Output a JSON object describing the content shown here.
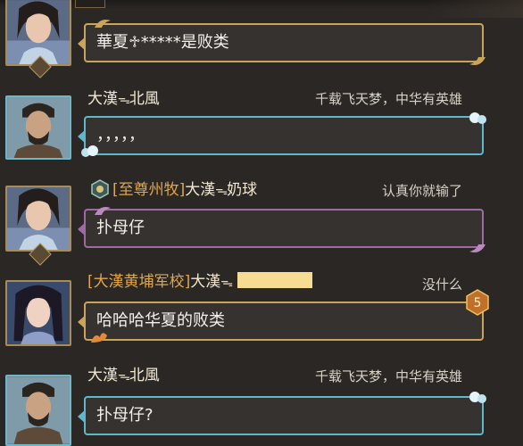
{
  "chat": {
    "messages": [
      {
        "title": "",
        "sender": "",
        "motto": "",
        "text": "華夏♱*****是败类",
        "frame": "gold"
      },
      {
        "title": "",
        "sender_prefix": "大漢",
        "sender_symbol": "ᯓ",
        "sender_suffix": "北風",
        "motto": "千载飞天梦，中华有英雄",
        "text": "，，，，，",
        "frame": "cyan"
      },
      {
        "title": "[至尊州牧]",
        "sender_prefix": "大漢",
        "sender_symbol": "ᯓ",
        "sender_suffix": "奶球",
        "motto": "认真你就输了",
        "text": "扑母仔",
        "frame": "purple"
      },
      {
        "title": "[大漢黄埔军校]",
        "sender_prefix": "大漢",
        "sender_symbol": "ᯓ",
        "sender_suffix": "",
        "motto": "没什么",
        "text": "哈哈哈华夏的败类",
        "frame": "gold",
        "level": "5"
      },
      {
        "title": "",
        "sender_prefix": "大漢",
        "sender_symbol": "ᯓ",
        "sender_suffix": "北風",
        "motto": "千载飞天梦，中华有英雄",
        "text": "扑母仔?",
        "frame": "cyan"
      }
    ]
  },
  "colors": {
    "background": "#2a2724",
    "guild_title": "#e1a64a",
    "name": "#f2e7d0",
    "frame_gold": "#c9a55c",
    "frame_purple": "#9f6aa3",
    "frame_cyan": "#5fb7cc"
  }
}
